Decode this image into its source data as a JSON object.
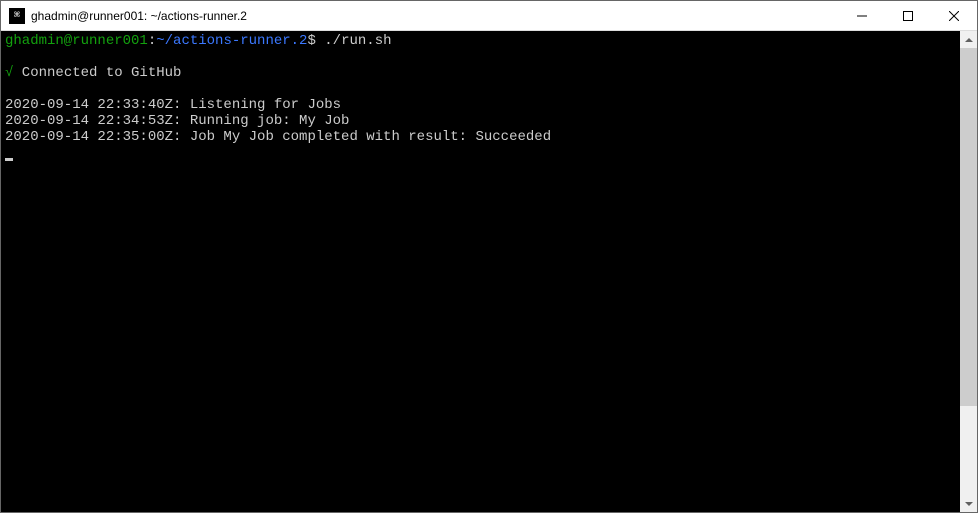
{
  "window": {
    "title": "ghadmin@runner001: ~/actions-runner.2"
  },
  "prompt": {
    "user_host": "ghadmin@runner001",
    "colon": ":",
    "path": "~/actions-runner.2",
    "dollar": "$",
    "command": "./run.sh"
  },
  "connect": {
    "check": "√",
    "text": " Connected to GitHub"
  },
  "log": {
    "line1": "2020-09-14 22:33:40Z: Listening for Jobs",
    "line2": "2020-09-14 22:34:53Z: Running job: My Job",
    "line3": "2020-09-14 22:35:00Z: Job My Job completed with result: Succeeded"
  }
}
